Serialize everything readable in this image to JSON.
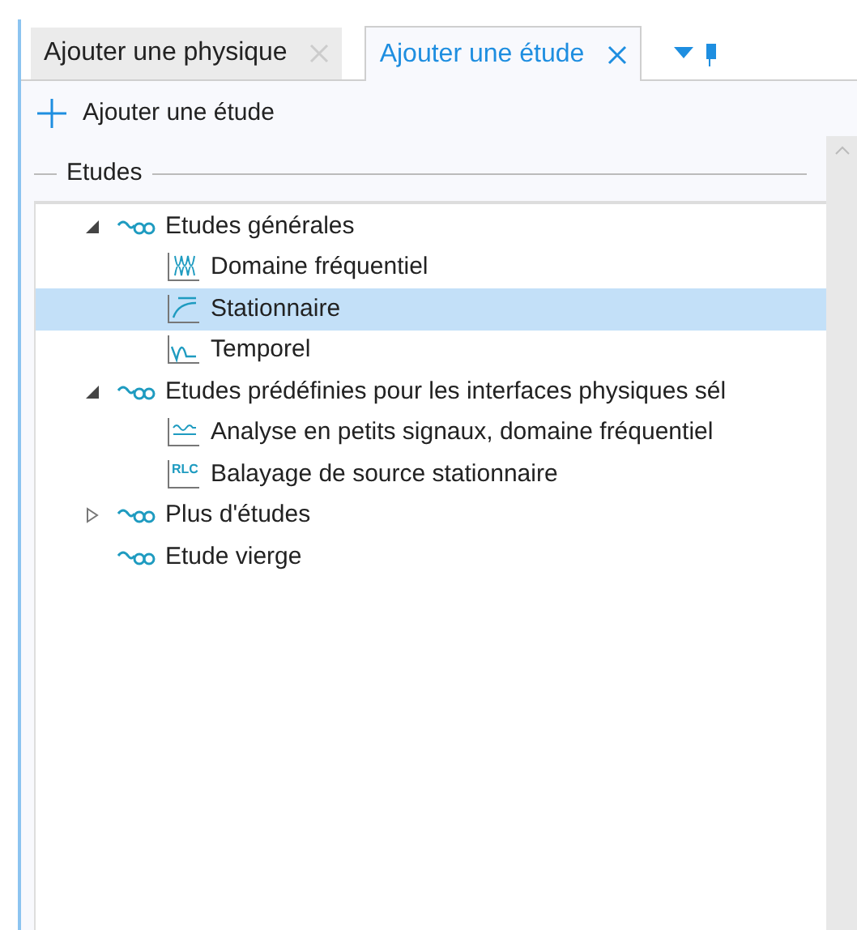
{
  "tabs": [
    {
      "label": "Ajouter une physique",
      "selected": false
    },
    {
      "label": "Ajouter une étude",
      "selected": true
    }
  ],
  "toolbar": {
    "add_button": "Ajouter une étude"
  },
  "group": {
    "title": "Etudes"
  },
  "tree": [
    {
      "label": "Etudes générales",
      "expanded": true,
      "selected": false,
      "children": [
        {
          "label": "Domaine fréquentiel",
          "kind": "frequency",
          "selected": false
        },
        {
          "label": "Stationnaire",
          "kind": "stationary",
          "selected": true
        },
        {
          "label": "Temporel",
          "kind": "transient",
          "selected": false
        }
      ]
    },
    {
      "label": "Etudes prédéfinies pour les interfaces physiques sél",
      "expanded": true,
      "selected": false,
      "children": [
        {
          "label": "Analyse en petits signaux, domaine fréquentiel",
          "kind": "smallsignal",
          "selected": false
        },
        {
          "label": "Balayage de source stationnaire",
          "kind": "rlc",
          "icon_label": "RLC",
          "selected": false
        }
      ]
    },
    {
      "label": "Plus d'études",
      "expanded": false,
      "selected": false
    },
    {
      "label": "Etude vierge",
      "selected": false
    }
  ]
}
